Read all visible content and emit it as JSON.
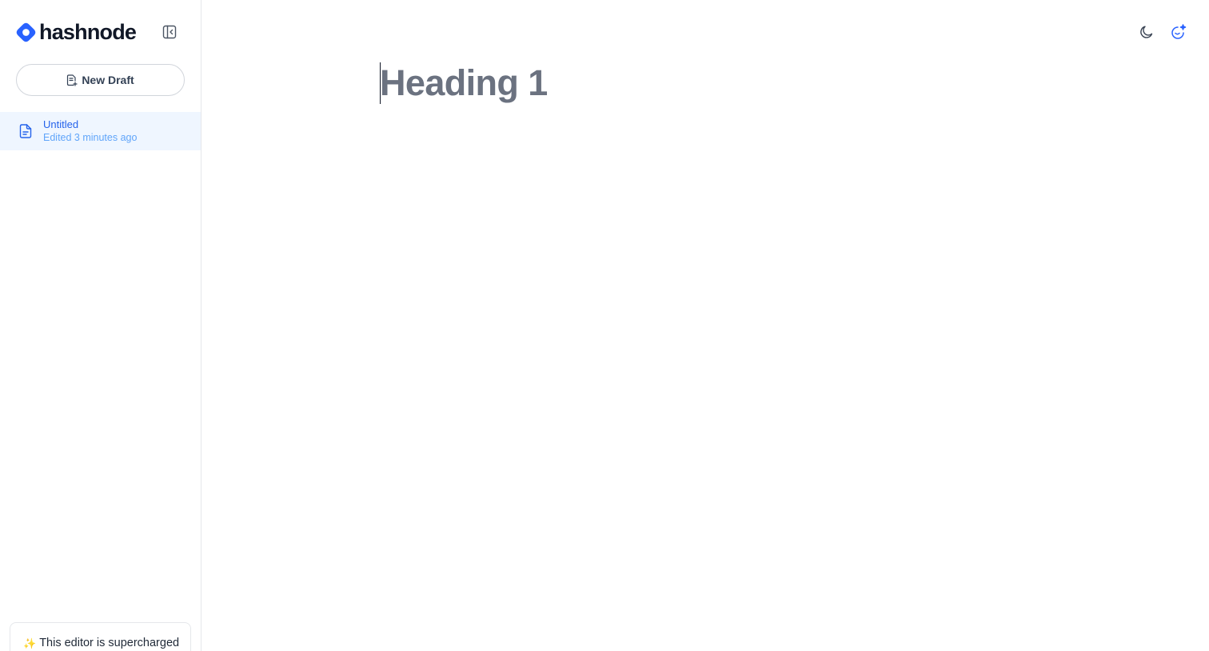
{
  "brand": {
    "name": "hashnode",
    "color": "#2962ff"
  },
  "sidebar": {
    "new_draft_label": "New Draft",
    "drafts": [
      {
        "title": "Untitled",
        "meta": "Edited 3 minutes ago"
      }
    ],
    "promo": {
      "sparkle": "✨",
      "text": "This editor is supercharged"
    }
  },
  "editor": {
    "heading_placeholder": "Heading 1"
  },
  "icons": {
    "collapse": "sidebar-collapse-icon",
    "new_draft": "document-plus-icon",
    "draft": "document-icon",
    "theme": "moon-icon",
    "ai": "ai-sparkle-icon"
  },
  "colors": {
    "accent": "#2962ff",
    "selected_bg": "#eff6ff",
    "placeholder": "#6b7280"
  }
}
